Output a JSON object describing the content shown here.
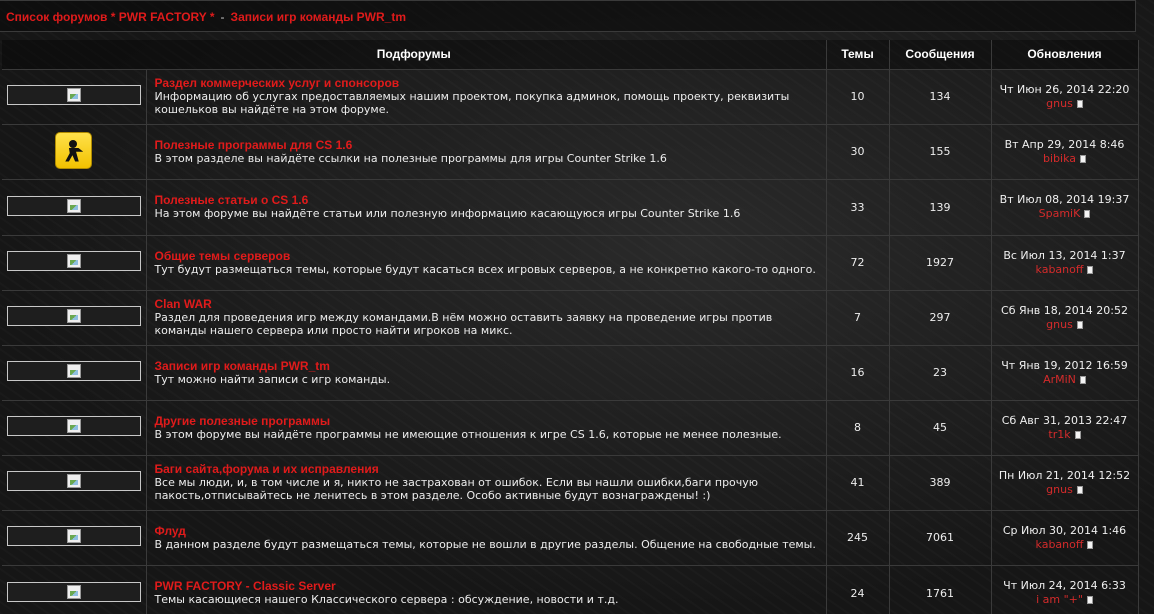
{
  "breadcrumb": {
    "root": "Список форумов * PWR FACTORY *",
    "separator": "-",
    "current": "Записи игр команды PWR_tm"
  },
  "columns": {
    "subforums": "Подфорумы",
    "topics": "Темы",
    "posts": "Сообщения",
    "updates": "Обновления"
  },
  "forums": [
    {
      "icon": "broken-image",
      "title": "Раздел коммерческих услуг и спонсоров",
      "desc": "Информацию об услугах предоставляемых нашим проектом, покупка админок, помощь проекту, реквизиты кошельков вы найдёте на этом форуме.",
      "topics": "10",
      "posts": "134",
      "date": "Чт Июн 26, 2014 22:20",
      "user": "gnus"
    },
    {
      "icon": "counter-strike",
      "title": "Полезные программы для CS 1.6",
      "desc": "В этом разделе вы найдёте ссылки на полезные программы для игры Counter Strike 1.6",
      "topics": "30",
      "posts": "155",
      "date": "Вт Апр 29, 2014 8:46",
      "user": "bibika"
    },
    {
      "icon": "broken-image",
      "title": "Полезные статьи о CS 1.6",
      "desc": "На этом форуме вы найдёте статьи или полезную информацию касающуюся игры Counter Strike 1.6",
      "topics": "33",
      "posts": "139",
      "date": "Вт Июл 08, 2014 19:37",
      "user": "SpamiK"
    },
    {
      "icon": "broken-image",
      "title": "Общие темы серверов",
      "desc": "Тут будут размещаться темы, которые будут касаться всех игровых серверов, а не конкретно какого-то одного.",
      "topics": "72",
      "posts": "1927",
      "date": "Вс Июл 13, 2014 1:37",
      "user": "kabanoff"
    },
    {
      "icon": "broken-image",
      "title": "Clan WAR",
      "desc": "Раздел для проведения игр между командами.В нём можно оставить заявку на проведение игры против команды нашего сервера или просто найти игроков на микс.",
      "topics": "7",
      "posts": "297",
      "date": "Сб Янв 18, 2014 20:52",
      "user": "gnus"
    },
    {
      "icon": "broken-image",
      "title": "Записи игр команды PWR_tm",
      "desc": "Тут можно найти записи с игр команды.",
      "topics": "16",
      "posts": "23",
      "date": "Чт Янв 19, 2012 16:59",
      "user": "ArMiN"
    },
    {
      "icon": "broken-image",
      "title": "Другие полезные программы",
      "desc": "В этом форуме вы найдёте программы не имеющие отношения к игре CS 1.6, которые не менее полезные.",
      "topics": "8",
      "posts": "45",
      "date": "Сб Авг 31, 2013 22:47",
      "user": "tr1k"
    },
    {
      "icon": "broken-image",
      "title": "Баги сайта,форума и их исправления",
      "desc": "Все мы люди, и, в том числе и я, никто не застрахован от ошибок. Если вы нашли ошибки,баги прочую пакость,отписывайтесь не ленитесь в этом разделе. Особо активные будут вознаграждены! :)",
      "topics": "41",
      "posts": "389",
      "date": "Пн Июл 21, 2014 12:52",
      "user": "gnus"
    },
    {
      "icon": "broken-image",
      "title": "Флуд",
      "desc": "В данном разделе будут размещаться темы, которые не вошли в другие разделы. Общение на свободные темы.",
      "topics": "245",
      "posts": "7061",
      "date": "Ср Июл 30, 2014 1:46",
      "user": "kabanoff"
    },
    {
      "icon": "broken-image",
      "title": "PWR FACTORY - Classic Server",
      "desc": "Темы касающиеся нашего Классического сервера : обсуждение, новости и т.д.",
      "topics": "24",
      "posts": "1761",
      "date": "Чт Июл 24, 2014 6:33",
      "user": "i am \"+\""
    }
  ]
}
